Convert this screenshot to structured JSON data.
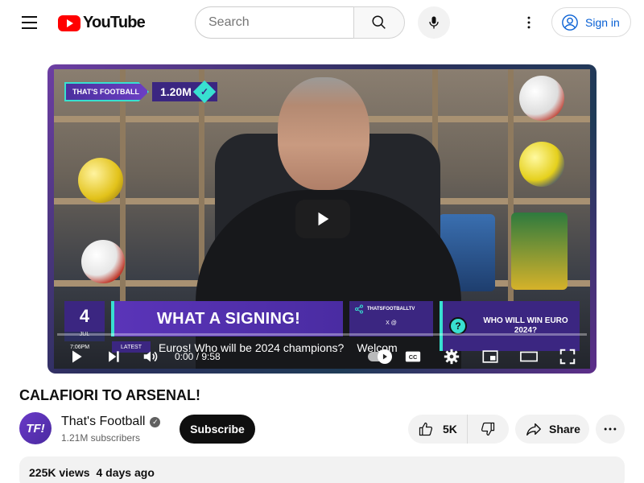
{
  "header": {
    "logo_text": "YouTube",
    "search_placeholder": "Search",
    "signin_label": "Sign in"
  },
  "player": {
    "overlay": {
      "brand": "THAT'S FOOTBALL",
      "subscriber_badge": "1.20M",
      "date_day": "4",
      "date_month": "JUL",
      "headline": "WHAT A SIGNING!",
      "social_handle": "THATSFOOTBALLTV",
      "social_icons": "X @",
      "poll_question": "WHO WILL WIN EURO 2024?",
      "latest_label": "LATEST",
      "ticker_time": "7:06PM",
      "ticker_text": "Euros! Who will be 2024 champions?",
      "ticker_text_2": "Welcom"
    },
    "time_current": "0:00",
    "time_separator": " / ",
    "time_total": "9:58",
    "progress": 0,
    "autoplay_on": true
  },
  "video": {
    "title": "CALAFIORI TO ARSENAL!"
  },
  "channel": {
    "avatar_text": "TF!",
    "name": "That's Football",
    "subscribers": "1.21M subscribers",
    "subscribe_label": "Subscribe"
  },
  "actions": {
    "like_count": "5K",
    "share_label": "Share"
  },
  "description": {
    "views": "225K views",
    "age": "4 days ago"
  },
  "colors": {
    "youtube_red": "#ff0000",
    "link_blue": "#065fd4",
    "overlay_purple": "#3b2681",
    "overlay_teal": "#38e0d0"
  }
}
